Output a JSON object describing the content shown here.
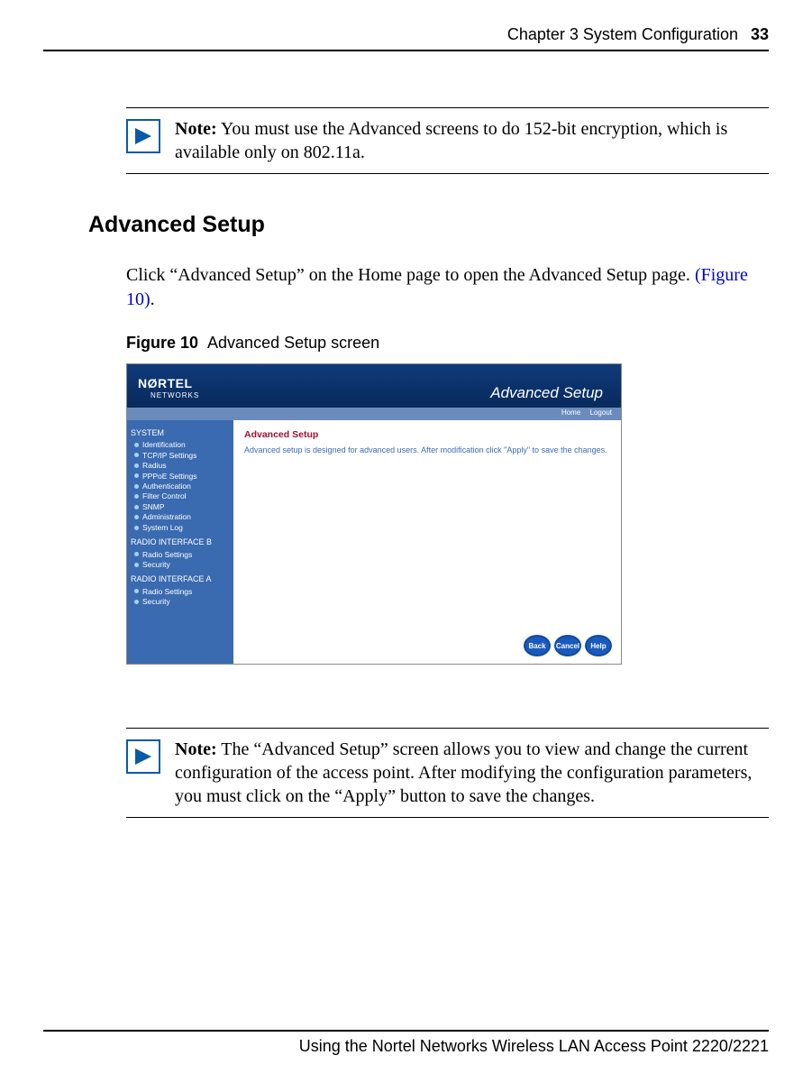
{
  "header": {
    "chapter": "Chapter 3  System Configuration",
    "page_number": "33"
  },
  "note1": {
    "label": "Note:",
    "text": " You must use the Advanced screens to do 152-bit encryption, which is available only on 802.11a."
  },
  "section_heading": "Advanced Setup",
  "body_para_pre": "Click “Advanced Setup” on the Home page to open the Advanced Setup page. ",
  "body_para_link": "(Figure 10)",
  "body_para_post": ".",
  "figure": {
    "label": "Figure 10",
    "caption": "Advanced Setup screen"
  },
  "screenshot": {
    "brand": "NØRTEL",
    "brand_sub": "NETWORKS",
    "title": "Advanced Setup",
    "topbar": {
      "home": "Home",
      "logout": "Logout"
    },
    "sidebar": {
      "group1_head": "SYSTEM",
      "group1": [
        "Identification",
        "TCP/IP Settings",
        "Radius",
        "PPPoE Settings",
        "Authentication",
        "Filter Control",
        "SNMP",
        "Administration",
        "System Log"
      ],
      "group2_head": "RADIO INTERFACE B",
      "group2": [
        "Radio Settings",
        "Security"
      ],
      "group3_head": "RADIO INTERFACE A",
      "group3": [
        "Radio Settings",
        "Security"
      ]
    },
    "panel": {
      "title": "Advanced Setup",
      "desc": "Advanced setup is designed for advanced users. After modification click \"Apply\" to save the changes."
    },
    "buttons": {
      "back": "Back",
      "cancel": "Cancel",
      "help": "Help"
    }
  },
  "note2": {
    "label": "Note:",
    "text": " The “Advanced Setup” screen allows you to view and change the current configuration of the access point. After modifying the configuration parameters, you must click on the “Apply” button to save the changes."
  },
  "footer": "Using the Nortel Networks Wireless LAN Access Point 2220/2221"
}
